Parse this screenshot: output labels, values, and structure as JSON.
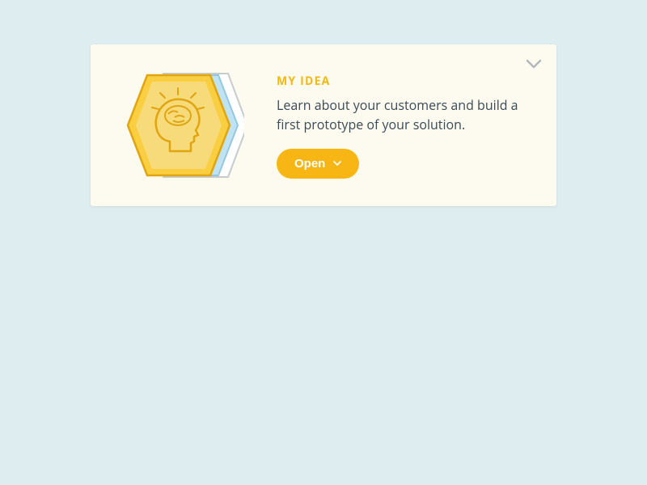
{
  "card": {
    "title": "MY IDEA",
    "description": "Learn about your customers and build a first prototype of your solution.",
    "button_label": "Open",
    "icon_name": "brain-idea",
    "colors": {
      "accent": "#f7b613",
      "card_bg": "#fdfaf0",
      "page_bg": "#deedef",
      "text": "#3a4a56"
    }
  }
}
